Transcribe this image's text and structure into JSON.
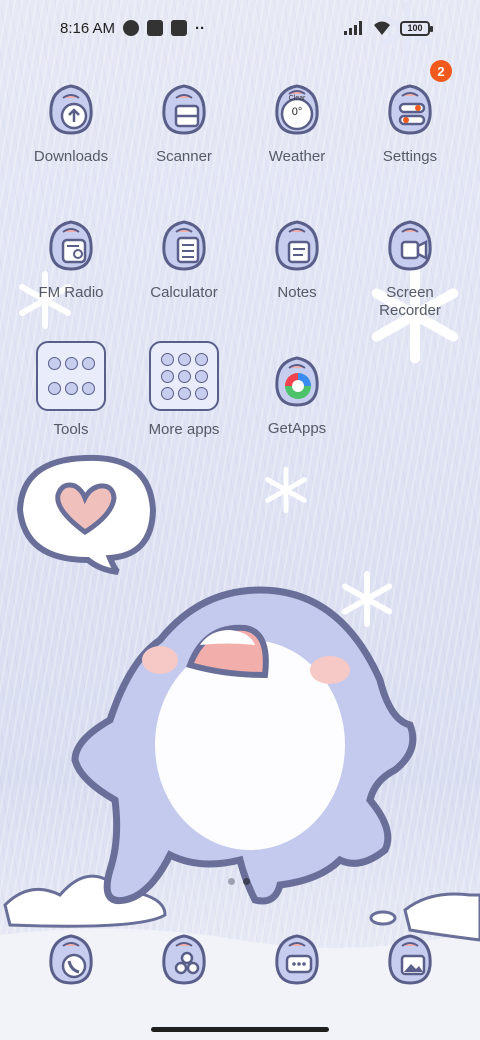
{
  "status_bar": {
    "time": "8:16 AM",
    "icons": [
      "data-saver-icon",
      "notification-square-icon",
      "upload-icon",
      "more-dots-icon"
    ],
    "battery": "100"
  },
  "apps_row1": [
    {
      "label": "Downloads",
      "glyph": "download-icon"
    },
    {
      "label": "Scanner",
      "glyph": "scanner-icon"
    },
    {
      "label": "Weather",
      "glyph": "weather-icon",
      "sub_top": "Clear",
      "sub_value": "0°"
    },
    {
      "label": "Settings",
      "glyph": "settings-icon",
      "badge": "2"
    }
  ],
  "apps_row2": [
    {
      "label": "FM Radio",
      "glyph": "radio-icon"
    },
    {
      "label": "Calculator",
      "glyph": "calculator-icon"
    },
    {
      "label": "Notes",
      "glyph": "notes-icon"
    },
    {
      "label": "Screen Recorder",
      "glyph": "screen-recorder-icon"
    }
  ],
  "apps_row3": [
    {
      "label": "Tools",
      "glyph": "folder-icon"
    },
    {
      "label": "More apps",
      "glyph": "folder-icon"
    },
    {
      "label": "GetApps",
      "glyph": "getapps-icon"
    }
  ],
  "dock": [
    {
      "glyph": "phone-icon"
    },
    {
      "glyph": "share-icon"
    },
    {
      "glyph": "messages-icon"
    },
    {
      "glyph": "gallery-icon"
    }
  ],
  "page_indicator": {
    "count": 2,
    "active": 2
  },
  "colors": {
    "badge": "#f25a1d",
    "icon_body": "#c7cdef",
    "outline": "#5a5f8a"
  }
}
